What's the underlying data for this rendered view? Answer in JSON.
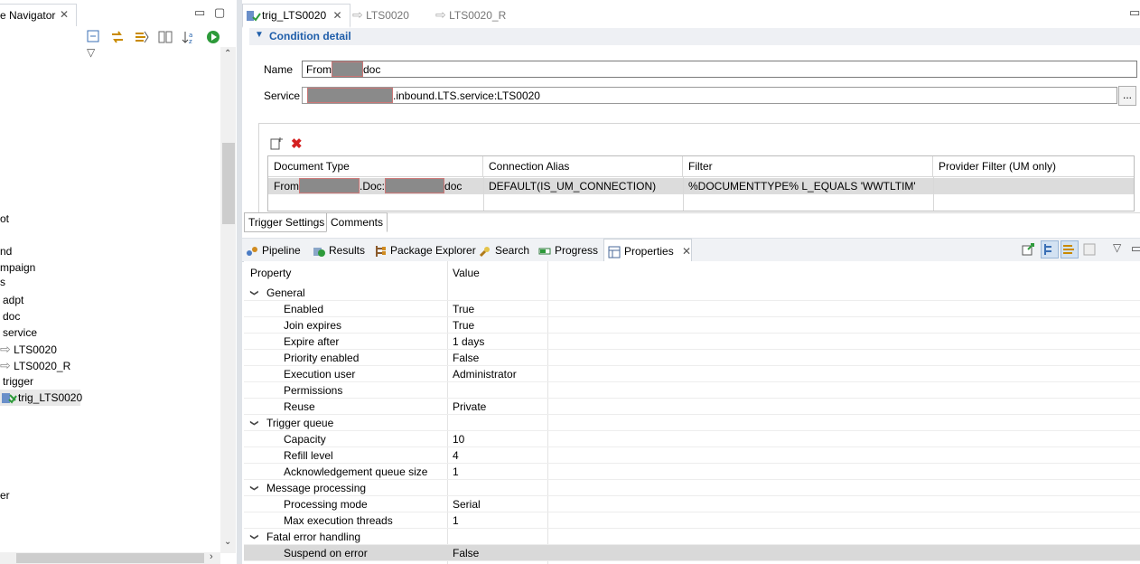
{
  "navigator": {
    "title": "e Navigator",
    "tree": [
      {
        "label": "ot"
      },
      {
        "label": "nd"
      },
      {
        "label": "mpaign"
      },
      {
        "label": "s"
      },
      {
        "label": "adpt"
      },
      {
        "label": "doc"
      },
      {
        "label": "service"
      },
      {
        "label": "LTS0020"
      },
      {
        "label": "LTS0020_R"
      },
      {
        "label": "trigger"
      },
      {
        "label": "trig_LTS0020"
      },
      {
        "label": "er"
      }
    ]
  },
  "editor": {
    "tabs": [
      {
        "label": "trig_LTS0020"
      },
      {
        "label": "LTS0020"
      },
      {
        "label": "LTS0020_R"
      }
    ],
    "section_title": "Condition detail",
    "name_label": "Name",
    "name_prefix": "From",
    "name_suffix": "doc",
    "service_label": "Service",
    "service_suffix": ".inbound.LTS.service:LTS0020",
    "browse_label": "...",
    "table": {
      "headers": [
        "Document Type",
        "Connection Alias",
        "Filter",
        "Provider Filter (UM only)"
      ],
      "row": {
        "doc_prefix": "From",
        "doc_mid": ".Doc:",
        "doc_suffix": "doc",
        "alias": "DEFAULT(IS_UM_CONNECTION)",
        "filter": "%DOCUMENTTYPE% L_EQUALS 'WWTLTIM'",
        "provider": ""
      }
    },
    "subtabs": [
      "Trigger Settings",
      "Comments"
    ]
  },
  "views": {
    "tabs": [
      "Pipeline",
      "Results",
      "Package Explorer",
      "Search",
      "Progress",
      "Properties"
    ]
  },
  "properties": {
    "col_property": "Property",
    "col_value": "Value",
    "groups": [
      {
        "name": "General",
        "rows": [
          {
            "name": "Enabled",
            "value": "True"
          },
          {
            "name": "Join expires",
            "value": "True"
          },
          {
            "name": "Expire after",
            "value": "1 days"
          },
          {
            "name": "Priority enabled",
            "value": "False"
          },
          {
            "name": "Execution user",
            "value": "Administrator"
          },
          {
            "name": "Permissions",
            "value": ""
          },
          {
            "name": "Reuse",
            "value": "Private"
          }
        ]
      },
      {
        "name": "Trigger queue",
        "rows": [
          {
            "name": "Capacity",
            "value": "10"
          },
          {
            "name": "Refill level",
            "value": "4"
          },
          {
            "name": "Acknowledgement queue size",
            "value": "1"
          }
        ]
      },
      {
        "name": "Message processing",
        "rows": [
          {
            "name": "Processing mode",
            "value": "Serial"
          },
          {
            "name": "Max execution threads",
            "value": "1"
          }
        ]
      },
      {
        "name": "Fatal error handling",
        "rows": [
          {
            "name": "Suspend on error",
            "value": "False"
          }
        ]
      }
    ]
  },
  "colors": {
    "accent": "#1f5eaa",
    "selected_row": "#d9d9d9"
  }
}
